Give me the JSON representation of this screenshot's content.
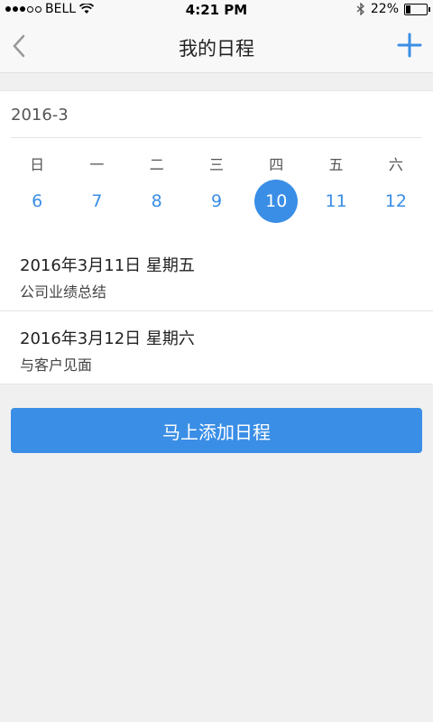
{
  "status_bar": {
    "carrier": "BELL",
    "time": "4:21 PM",
    "battery_percent": "22%",
    "battery_level": 0.22
  },
  "nav": {
    "title": "我的日程",
    "back_icon": "chevron-left-icon",
    "add_icon": "plus-icon"
  },
  "calendar": {
    "month": "2016-3",
    "weekdays": [
      "日",
      "一",
      "二",
      "三",
      "四",
      "五",
      "六"
    ],
    "dates": [
      "6",
      "7",
      "8",
      "9",
      "10",
      "11",
      "12"
    ],
    "selected_index": 4
  },
  "events": [
    {
      "date": "2016年3月11日  星期五",
      "title": "公司业绩总结"
    },
    {
      "date": "2016年3月12日  星期六",
      "title": "与客户见面"
    }
  ],
  "add_button_label": "马上添加日程",
  "colors": {
    "accent": "#3a8ee6",
    "background": "#f0f0f0"
  }
}
